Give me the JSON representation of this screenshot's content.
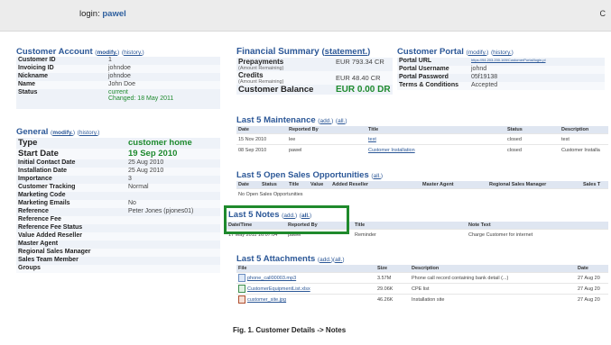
{
  "header": {
    "login_label": "login:",
    "username": "pawel",
    "corner": "C"
  },
  "customer_account": {
    "title": "Customer Account",
    "modify": "modify.",
    "history": "history.",
    "rows": [
      {
        "k": "Customer ID",
        "v": "1"
      },
      {
        "k": "Invoicing ID",
        "v": "johndoe"
      },
      {
        "k": "Nickname",
        "v": "johndoe"
      },
      {
        "k": "Name",
        "v": "John Doe"
      },
      {
        "k": "Status",
        "v": "current",
        "v2": "Changed: 18 May 2011"
      }
    ]
  },
  "general": {
    "title": "General",
    "modify": "modify.",
    "history": "history.",
    "type": {
      "k": "Type",
      "v": "customer home"
    },
    "start_date": {
      "k": "Start Date",
      "v": "19 Sep 2010"
    },
    "rows": [
      {
        "k": "Initial Contact Date",
        "v": "25 Aug 2010"
      },
      {
        "k": "Installation Date",
        "v": "25 Aug 2010"
      },
      {
        "k": "Importance",
        "v": "3"
      },
      {
        "k": "Customer Tracking",
        "v": "Normal"
      },
      {
        "k": "Marketing Code",
        "v": ""
      },
      {
        "k": "Marketing Emails",
        "v": "No"
      },
      {
        "k": "Reference",
        "v": "Peter Jones (pjones01)"
      },
      {
        "k": "Reference Fee",
        "v": ""
      },
      {
        "k": "Reference Fee Status",
        "v": ""
      },
      {
        "k": "Value Added Reseller",
        "v": ""
      },
      {
        "k": "Master Agent",
        "v": ""
      },
      {
        "k": "Regional Sales Manager",
        "v": ""
      },
      {
        "k": "Sales Team Member",
        "v": ""
      },
      {
        "k": "Groups",
        "v": ""
      }
    ]
  },
  "financial": {
    "title": "Financial Summary",
    "statement": "statement.",
    "prepayments": {
      "label": "Prepayments",
      "sub": "(Amount Remaining)",
      "value": "EUR 793.34 CR"
    },
    "credits": {
      "label": "Credits",
      "sub": "(Amount Remaining)",
      "value": "EUR 48.40 CR"
    },
    "balance": {
      "label": "Customer Balance",
      "value": "EUR 0.00 DR"
    }
  },
  "portal": {
    "title": "Customer Portal",
    "modify": "modify.",
    "history": "history.",
    "rows": [
      {
        "k": "Portal URL",
        "v": "https://94.203.200.169/CustomerPortal/login.pl"
      },
      {
        "k": "Portal Username",
        "v": "johnd"
      },
      {
        "k": "Portal Password",
        "v": "05f19138"
      },
      {
        "k": "Terms & Conditions",
        "v": "Accepted"
      }
    ]
  },
  "maintenance": {
    "title": "Last 5 Maintenance",
    "add": "add.",
    "all": "all.",
    "columns": [
      "Date",
      "Reported By",
      "Title",
      "Status",
      "Description"
    ],
    "rows": [
      [
        "15 Nov 2010",
        "lee",
        "test",
        "closed",
        "test"
      ],
      [
        "08 Sep 2010",
        "pawel",
        "Customer Installation",
        "closed",
        "Customer Installa"
      ]
    ]
  },
  "opportunities": {
    "title": "Last 5 Open Sales Opportunities",
    "all": "all.",
    "columns": [
      "Date",
      "Status",
      "Title",
      "Value",
      "Added Reseller",
      "Master Agent",
      "Regional Sales Manager",
      "Sales T"
    ],
    "empty": "No Open Sales Opportunities"
  },
  "notes": {
    "title": "Last 5 Notes",
    "add": "add.",
    "all": "all.",
    "columns": [
      "Date/Time",
      "Reported By",
      "Title",
      "Note Text"
    ],
    "rows": [
      [
        "17 May 2011 16:07:04",
        "pawel",
        "Reminder",
        "Charge Customer for internet"
      ]
    ]
  },
  "attachments": {
    "title": "Last 5 Attachments",
    "add": "add.",
    "all": "all.",
    "columns": [
      "File",
      "Size",
      "Description",
      "Date"
    ],
    "rows": [
      [
        "phone_call00003.mp3",
        "3.57M",
        "Phone call record containing bank detail (...)",
        "27 Aug 20"
      ],
      [
        "CustomerEquipmentList.xlsx",
        "29.06K",
        "CPE list",
        "27 Aug 20"
      ],
      [
        "customer_site.jpg",
        "46.26K",
        "Installation site",
        "27 Aug 20"
      ]
    ]
  },
  "caption": "Fig. 1. Customer Details -> Notes",
  "colors": {
    "accent": "#2b5797",
    "green": "#1e8a2e",
    "highlight": "#1f8a2c"
  }
}
